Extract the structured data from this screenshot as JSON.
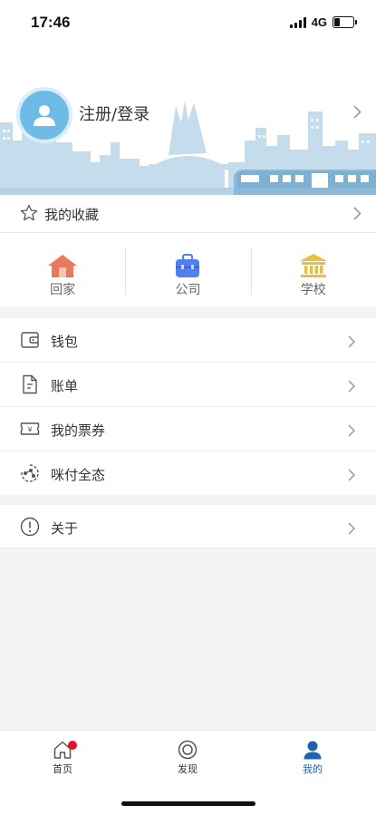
{
  "status_bar": {
    "time": "17:46",
    "network": "4G"
  },
  "profile": {
    "login_label": "注册/登录"
  },
  "favorites": {
    "label": "我的收藏"
  },
  "places": [
    {
      "label": "回家",
      "icon": "house-icon",
      "color": "#e8795d"
    },
    {
      "label": "公司",
      "icon": "briefcase-icon",
      "color": "#4f7ff0"
    },
    {
      "label": "学校",
      "icon": "school-icon",
      "color": "#e8c13c"
    }
  ],
  "menu": [
    {
      "label": "钱包",
      "icon": "wallet-icon"
    },
    {
      "label": "账单",
      "icon": "bill-icon"
    },
    {
      "label": "我的票券",
      "icon": "ticket-icon"
    },
    {
      "label": "咪付全态",
      "icon": "mifu-icon"
    }
  ],
  "about": {
    "label": "关于",
    "icon": "info-icon"
  },
  "tabbar": {
    "tabs": [
      {
        "label": "首页",
        "icon": "home-icon",
        "active": false,
        "badge": true
      },
      {
        "label": "发现",
        "icon": "discover-icon",
        "active": false
      },
      {
        "label": "我的",
        "icon": "profile-icon",
        "active": true
      }
    ]
  },
  "colors": {
    "accent": "#1e63ad",
    "skyline": "#c4dcec",
    "badge": "#e8121e"
  }
}
